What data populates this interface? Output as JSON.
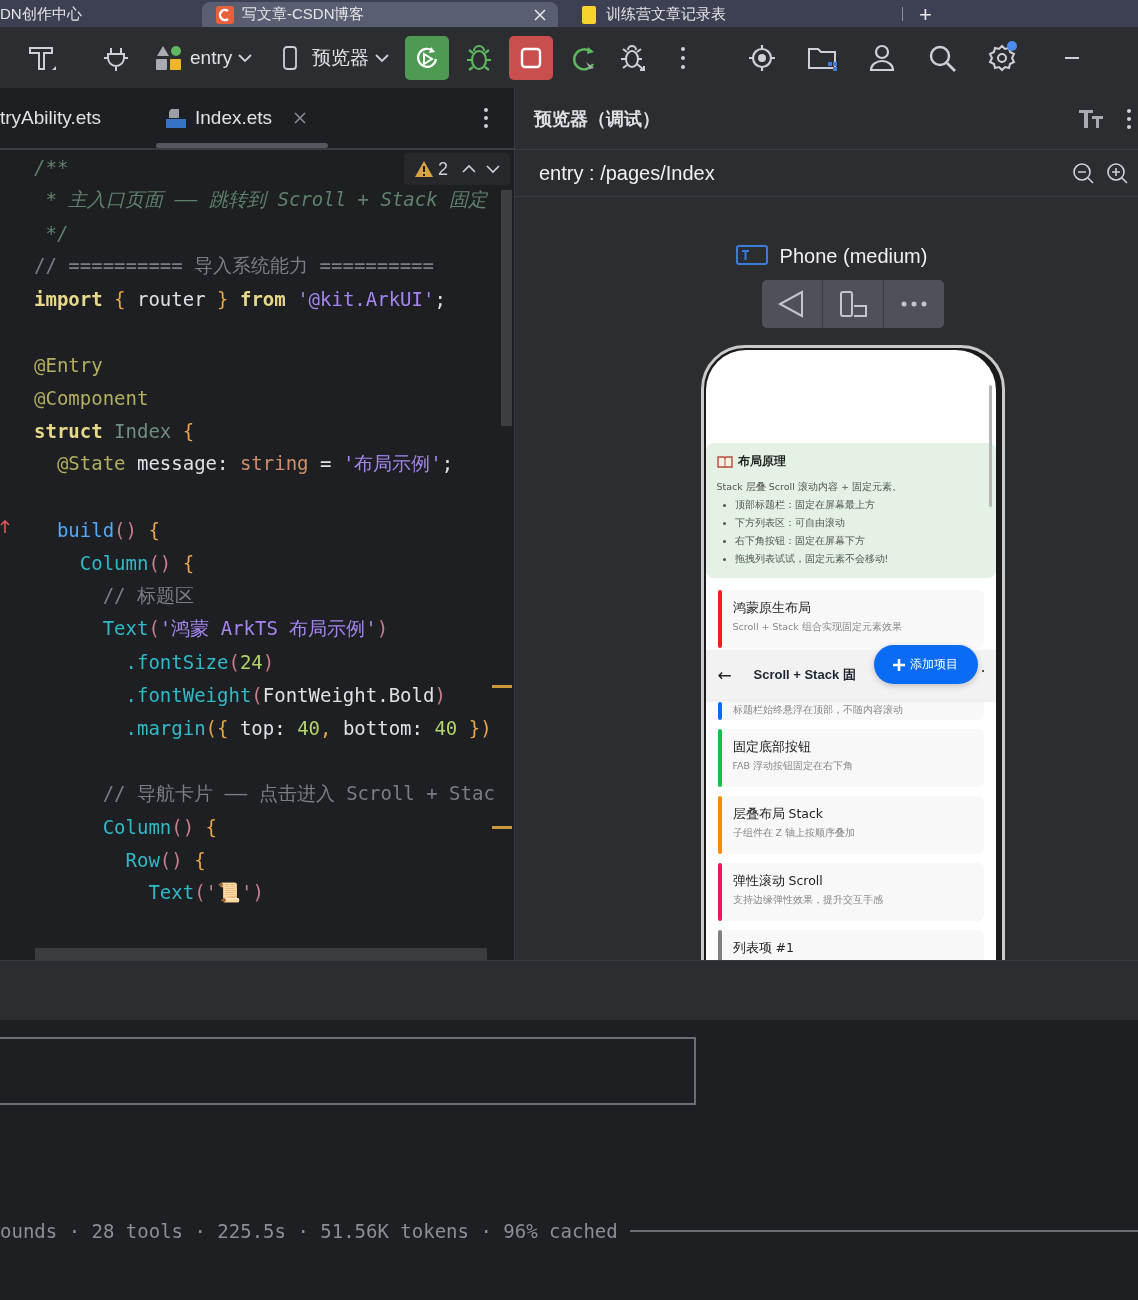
{
  "browser_tabs": [
    {
      "label": "DN创作中心",
      "selected": false,
      "kind": "plain"
    },
    {
      "label": "写文章-CSDN博客",
      "selected": true,
      "kind": "csdn"
    },
    {
      "label": "训练营文章记录表",
      "selected": false,
      "kind": "sheet"
    }
  ],
  "new_tab": "+",
  "toolbar": {
    "module": "entry",
    "device": "预览器"
  },
  "editor": {
    "tabs": [
      {
        "label": "tryAbility.ets",
        "selected": false,
        "kind": "plain"
      },
      {
        "label": "Index.ets",
        "selected": true,
        "kind": "ets"
      }
    ],
    "warning_count": "2",
    "lines": [
      {
        "kind": "code",
        "tokens": [
          {
            "t": "/**",
            "kind": "doc"
          }
        ]
      },
      {
        "kind": "code",
        "tokens": [
          {
            "t": " * 主入口页面 —— 跳转到 Scroll + Stack 固定",
            "kind": "doc"
          }
        ]
      },
      {
        "kind": "code",
        "tokens": [
          {
            "t": " */",
            "kind": "doc"
          }
        ]
      },
      {
        "kind": "code",
        "tokens": [
          {
            "t": "// ========== 导入系统能力 ==========",
            "kind": "lc"
          }
        ]
      },
      {
        "kind": "code",
        "tokens": [
          {
            "t": "import",
            "kind": "kw"
          },
          {
            "t": " { ",
            "kind": "br"
          },
          {
            "t": "router",
            "kind": "id"
          },
          {
            "t": " } ",
            "kind": "br"
          },
          {
            "t": "from",
            "kind": "kw"
          },
          {
            "t": " '@kit.ArkUI'",
            "kind": "str"
          },
          {
            "t": ";",
            "kind": "id"
          }
        ]
      },
      {
        "kind": "blank"
      },
      {
        "kind": "code",
        "tokens": [
          {
            "t": "@Entry",
            "kind": "dec"
          }
        ]
      },
      {
        "kind": "code",
        "tokens": [
          {
            "t": "@Component",
            "kind": "dec"
          }
        ]
      },
      {
        "kind": "code",
        "tokens": [
          {
            "t": "struct",
            "kind": "kw"
          },
          {
            "t": " Index",
            "kind": "cls"
          },
          {
            "t": " {",
            "kind": "br"
          }
        ]
      },
      {
        "kind": "code",
        "tokens": [
          {
            "t": "  @State",
            "kind": "dec"
          },
          {
            "t": " message: ",
            "kind": "id"
          },
          {
            "t": "string",
            "kind": "ty"
          },
          {
            "t": " = ",
            "kind": "id"
          },
          {
            "t": "'布局示例'",
            "kind": "str"
          },
          {
            "t": ";",
            "kind": "id"
          }
        ]
      },
      {
        "kind": "blank"
      },
      {
        "kind": "code",
        "overridden": true,
        "tokens": [
          {
            "t": "  build",
            "kind": "fn"
          },
          {
            "t": "()",
            "kind": "paren"
          },
          {
            "t": " {",
            "kind": "br"
          }
        ]
      },
      {
        "kind": "code",
        "tokens": [
          {
            "t": "    Column",
            "kind": "comp"
          },
          {
            "t": "()",
            "kind": "paren"
          },
          {
            "t": " {",
            "kind": "br"
          }
        ]
      },
      {
        "kind": "code",
        "tokens": [
          {
            "t": "      // 标题区",
            "kind": "lc"
          }
        ]
      },
      {
        "kind": "code",
        "tokens": [
          {
            "t": "      Text",
            "kind": "comp"
          },
          {
            "t": "(",
            "kind": "paren"
          },
          {
            "t": "'鸿蒙 ArkTS 布局示例'",
            "kind": "str"
          },
          {
            "t": ")",
            "kind": "paren"
          }
        ]
      },
      {
        "kind": "code",
        "tokens": [
          {
            "t": "        .fontSize",
            "kind": "comp"
          },
          {
            "t": "(",
            "kind": "paren"
          },
          {
            "t": "24",
            "kind": "num"
          },
          {
            "t": ")",
            "kind": "paren"
          }
        ]
      },
      {
        "kind": "code",
        "tokens": [
          {
            "t": "        .fontWeight",
            "kind": "comp"
          },
          {
            "t": "(",
            "kind": "paren"
          },
          {
            "t": "FontWeight.Bold",
            "kind": "id"
          },
          {
            "t": ")",
            "kind": "paren"
          }
        ]
      },
      {
        "kind": "code",
        "tokens": [
          {
            "t": "        .margin",
            "kind": "comp"
          },
          {
            "t": "({",
            "kind": "br"
          },
          {
            "t": " top: ",
            "kind": "id"
          },
          {
            "t": "40",
            "kind": "num"
          },
          {
            "t": ", ",
            "kind": "br"
          },
          {
            "t": "bottom: ",
            "kind": "id"
          },
          {
            "t": "40",
            "kind": "num"
          },
          {
            "t": " })",
            "kind": "br"
          }
        ]
      },
      {
        "kind": "blank"
      },
      {
        "kind": "code",
        "tokens": [
          {
            "t": "      // 导航卡片 —— 点击进入 Scroll + Stac",
            "kind": "lc"
          }
        ]
      },
      {
        "kind": "code",
        "tokens": [
          {
            "t": "      Column",
            "kind": "comp"
          },
          {
            "t": "()",
            "kind": "paren"
          },
          {
            "t": " {",
            "kind": "br"
          }
        ]
      },
      {
        "kind": "code",
        "tokens": [
          {
            "t": "        Row",
            "kind": "comp"
          },
          {
            "t": "()",
            "kind": "paren"
          },
          {
            "t": " {",
            "kind": "br"
          }
        ]
      },
      {
        "kind": "code",
        "tokens": [
          {
            "t": "          Text",
            "kind": "comp"
          },
          {
            "t": "('",
            "kind": "paren"
          },
          {
            "t": "📜",
            "kind": "str"
          },
          {
            "t": "')",
            "kind": "paren"
          }
        ]
      }
    ]
  },
  "preview": {
    "title": "预览器（调试）",
    "path": "entry : /pages/Index",
    "device": "Phone (medium)",
    "phone": {
      "info": {
        "title": "布局原理",
        "lines": [
          {
            "kind": "text",
            "text": "Stack 层叠 Scroll 滚动内容 + 固定元素。"
          },
          {
            "kind": "bullet",
            "text": "顶部标题栏：固定在屏幕最上方"
          },
          {
            "kind": "bullet",
            "text": "下方列表区：可自由滚动"
          },
          {
            "kind": "bullet",
            "text": "右下角按钮：固定在屏幕下方"
          },
          {
            "kind": "bullet",
            "text": "拖拽列表试试，固定元素不会移动!"
          }
        ]
      },
      "cards": [
        {
          "title": "鸿蒙原生布局",
          "subtitle": "Scroll + Stack 组合实现固定元素效果",
          "color": "#f51d1d"
        },
        {
          "subtitle": "标题栏始终悬浮在顶部，不随内容滚动",
          "color": "#0a6cf5"
        },
        {
          "title": "固定底部按钮",
          "subtitle": "FAB 浮动按钮固定在右下角",
          "color": "#12c24a"
        },
        {
          "title": "层叠布局 Stack",
          "subtitle": "子组件在 Z 轴上按顺序叠加",
          "color": "#ff8c00"
        },
        {
          "title": "弹性滚动 Scroll",
          "subtitle": "支持边缘弹性效果，提升交互手感",
          "color": "#f0145a"
        },
        {
          "title": "列表项 #1",
          "color": "#808080"
        }
      ],
      "header": {
        "back": "←",
        "title": "Scroll + Stack 固",
        "more": "·"
      },
      "fab": {
        "label": "添加项目"
      }
    }
  },
  "terminal": {
    "status": "ounds · 28 tools · 225.5s · 51.56K tokens · 96% cached"
  }
}
